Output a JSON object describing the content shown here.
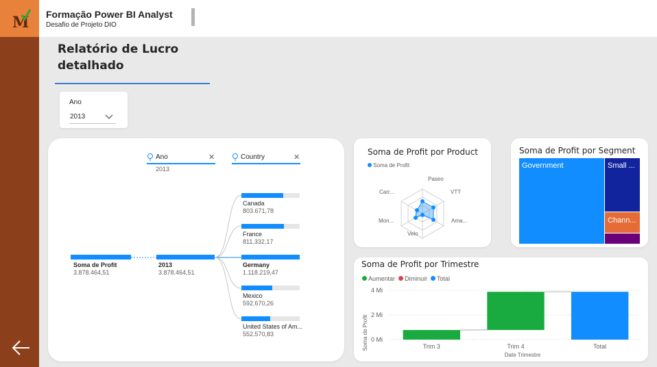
{
  "header": {
    "title": "Formação Power BI Analyst",
    "subtitle": "Desafio de Projeto DIO",
    "logo_letter": "M"
  },
  "page": {
    "title_line1": "Relatório de Lucro",
    "title_line2": "detalhado"
  },
  "slicer": {
    "label": "Ano",
    "value": "2013"
  },
  "decomp_tree": {
    "filters": [
      {
        "label": "Ano",
        "value": "2013"
      },
      {
        "label": "Country",
        "value": ""
      }
    ],
    "root": {
      "label": "Soma de Profit",
      "value": "3.878.464,51"
    },
    "level1": {
      "label": "2013",
      "value": "3.878.464,51"
    },
    "countries": [
      {
        "label": "Canada",
        "value": "803.671,78",
        "share": 0.72
      },
      {
        "label": "France",
        "value": "811.332,17",
        "share": 0.73
      },
      {
        "label": "Germany",
        "value": "1.118.219,47",
        "share": 1.0
      },
      {
        "label": "Mexico",
        "value": "592.670,26",
        "share": 0.53
      },
      {
        "label": "United States of Am...",
        "value": "552.570,83",
        "share": 0.49
      }
    ]
  },
  "radar": {
    "title": "Soma de Profit por Product",
    "legend": "Soma de Profit",
    "axes": [
      "Paseo",
      "VTT",
      "Ama...",
      "Velo",
      "Mon...",
      "Carr..."
    ]
  },
  "treemap": {
    "title": "Soma de Profit por Segment",
    "items": [
      {
        "label": "Government",
        "color": "#118dff"
      },
      {
        "label": "Small ...",
        "color": "#12239e"
      },
      {
        "label": "Chann...",
        "color": "#e66c37"
      },
      {
        "label": "",
        "color": "#6b007b"
      }
    ]
  },
  "chart_data": {
    "type": "bar",
    "title": "Soma de Profit por Trimestre",
    "xlabel": "Date Trimestre",
    "ylabel": "Soma de Profit",
    "categories": [
      "Trim 3",
      "Trim 4",
      "Total"
    ],
    "legend": [
      {
        "name": "Aumentar",
        "color": "#1aab40"
      },
      {
        "name": "Diminuir",
        "color": "#d64550"
      },
      {
        "name": "Total",
        "color": "#118dff"
      }
    ],
    "waterfall": [
      {
        "category": "Trim 3",
        "start": 0,
        "end": 0.78,
        "kind": "Aumentar"
      },
      {
        "category": "Trim 4",
        "start": 0.78,
        "end": 3.88,
        "kind": "Aumentar"
      },
      {
        "category": "Total",
        "start": 0,
        "end": 3.88,
        "kind": "Total"
      }
    ],
    "yticks": [
      "0 Mi",
      "2 Mi",
      "4 Mi"
    ],
    "ylim": [
      0,
      4
    ]
  },
  "nav": {
    "back_icon": "arrow-left-icon"
  }
}
